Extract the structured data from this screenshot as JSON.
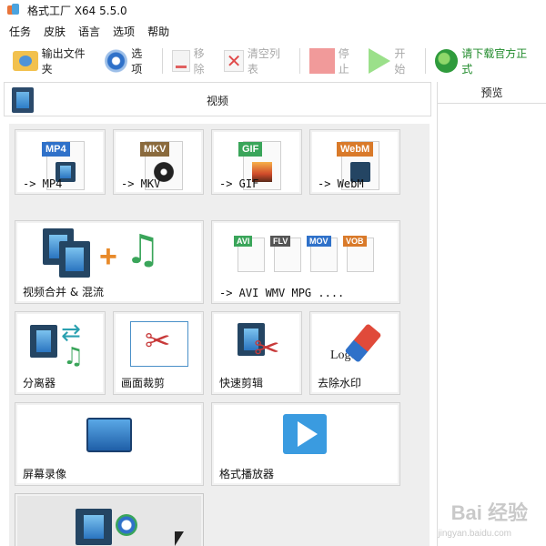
{
  "window": {
    "title": "格式工厂 X64 5.5.0"
  },
  "menu": [
    "任务",
    "皮肤",
    "语言",
    "选项",
    "帮助"
  ],
  "toolbar": {
    "output_folder": "输出文件夹",
    "options": "选项",
    "remove": "移除",
    "clear_list": "清空列表",
    "stop": "停止",
    "start": "开始",
    "download": "请下载官方正式"
  },
  "left_header": {
    "label": "视频"
  },
  "preview": {
    "label": "预览"
  },
  "tiles": {
    "mp4": {
      "badge": "MP4",
      "badge_color": "#2f71c9",
      "label": "-> MP4"
    },
    "mkv": {
      "badge": "MKV",
      "badge_color": "#8a6a3d",
      "label": "-> MKV"
    },
    "gif": {
      "badge": "GIF",
      "badge_color": "#3aa55a",
      "label": "-> GIF"
    },
    "webm": {
      "badge": "WebM",
      "badge_color": "#d97a2a",
      "label": "-> WebM"
    },
    "merge": {
      "label": "视频合并 & 混流"
    },
    "multi": {
      "label": "-> AVI WMV MPG ....",
      "badges": [
        "AVI",
        "FLV",
        "MOV",
        "VOB"
      ]
    },
    "splitter": {
      "label": "分离器"
    },
    "crop": {
      "label": "画面裁剪"
    },
    "quickcut": {
      "label": "快速剪辑"
    },
    "watermark": {
      "label": "去除水印",
      "logo_text": "Logo"
    },
    "screen": {
      "label": "屏幕录像"
    },
    "player": {
      "label": "格式播放器"
    }
  },
  "watermark_overlay": {
    "text": "Bai 经验",
    "sub": "jingyan.baidu.com"
  }
}
